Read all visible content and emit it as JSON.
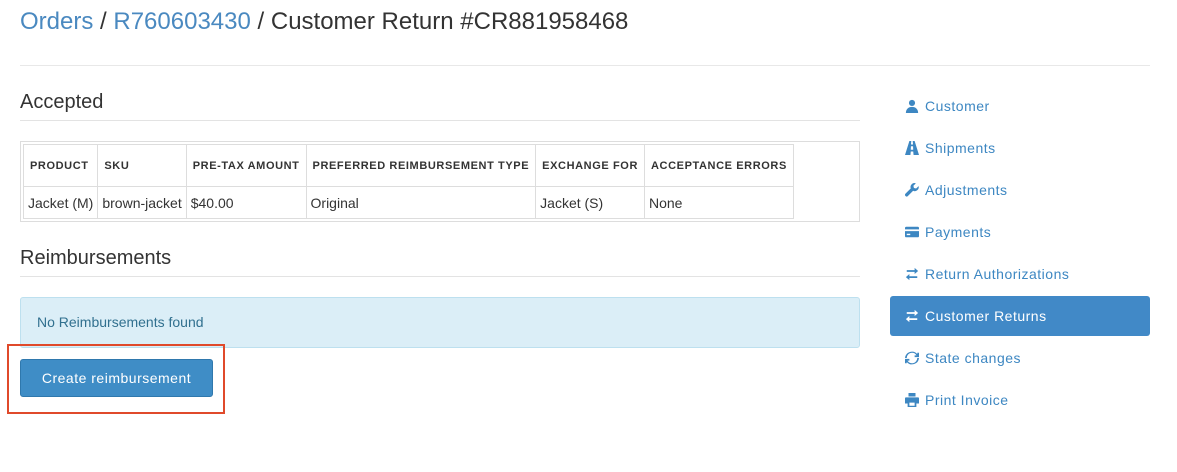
{
  "breadcrumb": {
    "orders_link": "Orders",
    "order_link": "R760603430",
    "separator": "/",
    "current": "Customer Return #CR881958468"
  },
  "accepted": {
    "title": "Accepted",
    "columns": [
      "Product",
      "SKU",
      "Pre-Tax Amount",
      "Preferred Reimbursement Type",
      "Exchange For",
      "Acceptance Errors"
    ],
    "rows": [
      {
        "product": "Jacket (M)",
        "sku": "brown-jacket",
        "pre_tax_amount": "$40.00",
        "reimbursement_type": "Original",
        "exchange_for": "Jacket (S)",
        "acceptance_errors": "None"
      }
    ]
  },
  "reimbursements": {
    "title": "Reimbursements",
    "empty_message": "No Reimbursements found",
    "create_button": "Create reimbursement"
  },
  "sidebar": {
    "items": [
      {
        "label": "Customer",
        "icon": "user-icon",
        "active": false
      },
      {
        "label": "Shipments",
        "icon": "road-icon",
        "active": false
      },
      {
        "label": "Adjustments",
        "icon": "wrench-icon",
        "active": false
      },
      {
        "label": "Payments",
        "icon": "credit-card-icon",
        "active": false
      },
      {
        "label": "Return Authorizations",
        "icon": "transfer-icon",
        "active": false
      },
      {
        "label": "Customer Returns",
        "icon": "transfer-icon",
        "active": true
      },
      {
        "label": "State changes",
        "icon": "refresh-icon",
        "active": false
      },
      {
        "label": "Print Invoice",
        "icon": "print-icon",
        "active": false
      }
    ]
  },
  "colors": {
    "link": "#4a89c0",
    "primary": "#3f8dc6",
    "active_nav": "#4189c7",
    "alert_bg": "#dbeef7",
    "highlight": "#e04a2b"
  }
}
